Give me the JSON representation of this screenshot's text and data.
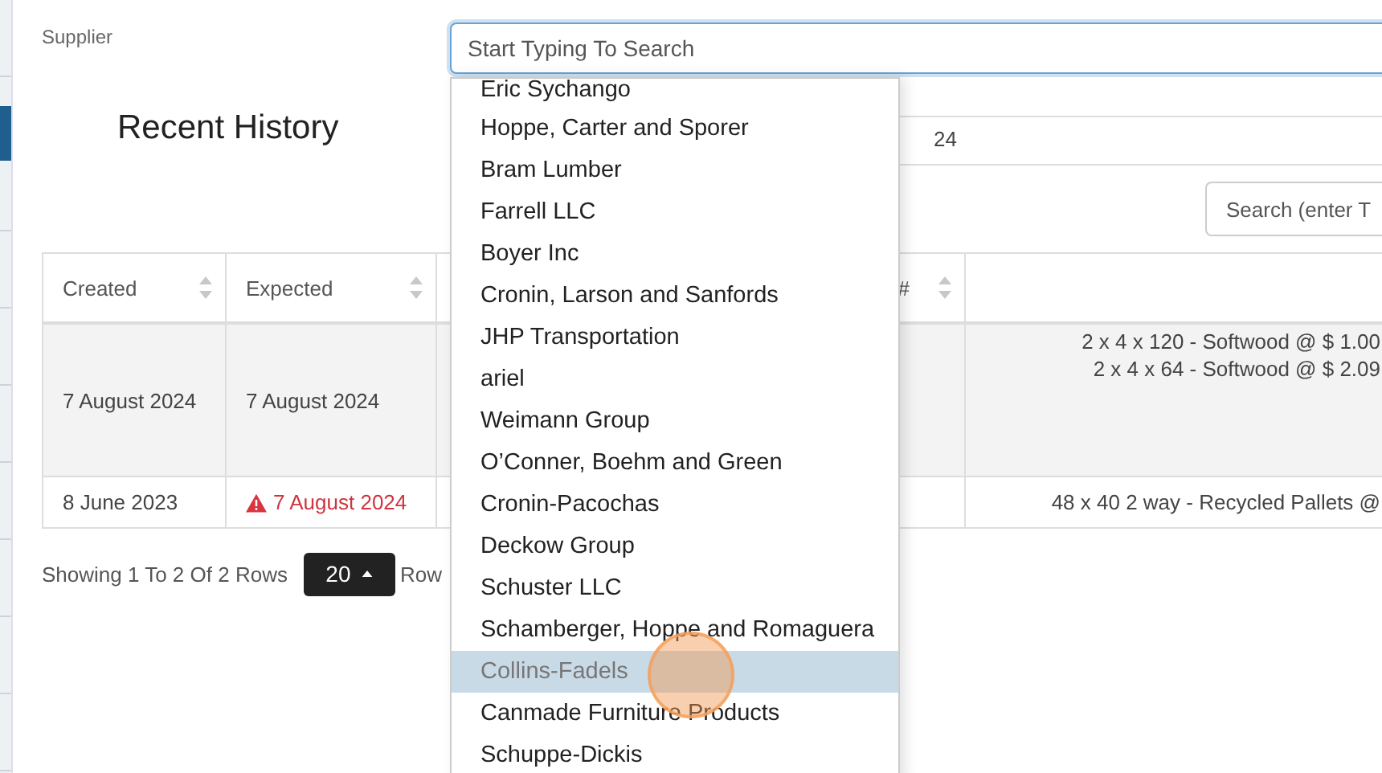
{
  "supplier": {
    "label": "Supplier",
    "placeholder": "Start Typing To Search",
    "focused": true,
    "options": [
      {
        "label": "Eric Sychango",
        "selected": false
      },
      {
        "label": "Hoppe, Carter and Sporer",
        "selected": false
      },
      {
        "label": "Bram Lumber",
        "selected": false
      },
      {
        "label": "Farrell LLC",
        "selected": false
      },
      {
        "label": "Boyer Inc",
        "selected": false
      },
      {
        "label": "Cronin, Larson and Sanfords",
        "selected": false
      },
      {
        "label": "JHP Transportation",
        "selected": false
      },
      {
        "label": "ariel",
        "selected": false
      },
      {
        "label": "Weimann Group",
        "selected": false
      },
      {
        "label": "O’Conner, Boehm and Green",
        "selected": false
      },
      {
        "label": "Cronin-Pacochas",
        "selected": false
      },
      {
        "label": "Deckow Group",
        "selected": false
      },
      {
        "label": "Schuster LLC",
        "selected": false
      },
      {
        "label": "Schamberger, Hoppe and Romaguera",
        "selected": false
      },
      {
        "label": "Collins-Fadels",
        "selected": true
      },
      {
        "label": "Canmade Furniture Products",
        "selected": false
      },
      {
        "label": "Schuppe-Dickis",
        "selected": false
      }
    ]
  },
  "heading": "Recent History",
  "date_field": {
    "value": "24"
  },
  "table_search": {
    "placeholder": "Search (enter T"
  },
  "table": {
    "columns": [
      {
        "label": "Created",
        "sortable": true
      },
      {
        "label": "Expected",
        "sortable": true
      },
      {
        "label": "#",
        "sortable": true
      },
      {
        "sortable": false
      }
    ],
    "rows": [
      {
        "created": "7 August 2024",
        "expected": "7 August 2024",
        "overdue": false,
        "items": [
          "2 x 4 x 120 - Softwood @ $ 1.00",
          "2 x 4 x 64 - Softwood @ $ 2.09"
        ]
      },
      {
        "created": "8 June 2023",
        "expected": "7 August 2024",
        "overdue": true,
        "items": [
          "48 x 40 2 way - Recycled Pallets @"
        ]
      }
    ]
  },
  "footer": {
    "summary": "Showing 1 To 2 Of 2 Rows",
    "page_size": "20",
    "page_size_suffix": "Row"
  }
}
